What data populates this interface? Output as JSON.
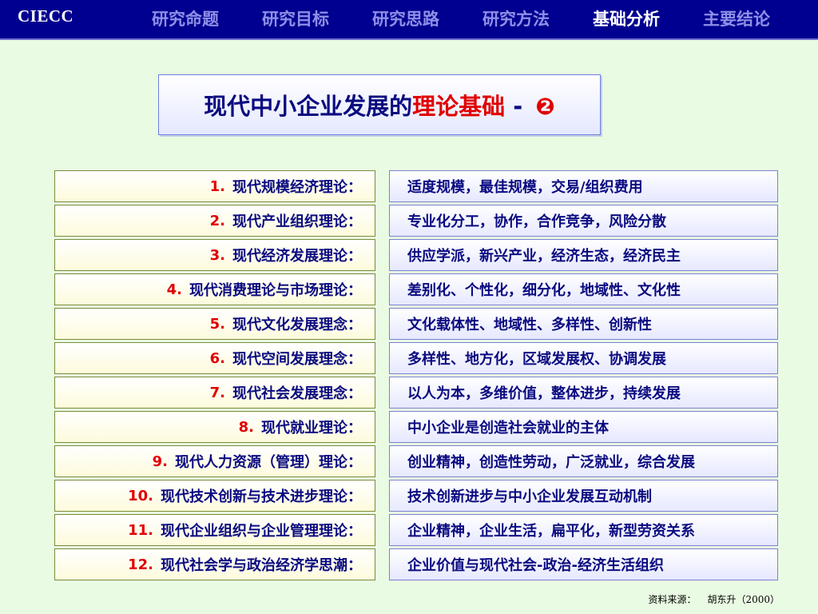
{
  "header": {
    "brand": "CIECC",
    "nav": [
      "研究命题",
      "研究目标",
      "研究思路",
      "研究方法",
      "基础分析",
      "主要结论"
    ],
    "active_index": 4
  },
  "title": {
    "prefix": "现代中小企业发展的",
    "highlight": "理论基础",
    "separator": " - ",
    "mark": "❷"
  },
  "theories": [
    {
      "num": "1.",
      "label": "现代规模经济理论：",
      "desc": "适度规模，最佳规模，交易/组织费用"
    },
    {
      "num": "2.",
      "label": "现代产业组织理论：",
      "desc": "专业化分工，协作，合作竞争，风险分散"
    },
    {
      "num": "3.",
      "label": "现代经济发展理论：",
      "desc": "供应学派，新兴产业，经济生态，经济民主"
    },
    {
      "num": "4.",
      "label": "现代消费理论与市场理论：",
      "desc": "差别化、个性化，细分化，地域性、文化性"
    },
    {
      "num": "5.",
      "label": "现代文化发展理念：",
      "desc": "文化载体性、地域性、多样性、创新性"
    },
    {
      "num": "6.",
      "label": "现代空间发展理念：",
      "desc": "多样性、地方化，区域发展权、协调发展"
    },
    {
      "num": "7.",
      "label": "现代社会发展理念：",
      "desc": "以人为本，多维价值，整体进步，持续发展"
    },
    {
      "num": "8.",
      "label": "现代就业理论：",
      "desc": "中小企业是创造社会就业的主体"
    },
    {
      "num": "9.",
      "label": "现代人力资源（管理）理论：",
      "desc": "创业精神，创造性劳动，广泛就业，综合发展"
    },
    {
      "num": "10.",
      "label": "现代技术创新与技术进步理论：",
      "desc": "技术创新进步与中小企业发展互动机制"
    },
    {
      "num": "11.",
      "label": "现代企业组织与企业管理理论：",
      "desc": "企业精神，企业生活，扁平化，新型劳资关系"
    },
    {
      "num": "12.",
      "label": "现代社会学与政治经济学思潮：",
      "desc": "企业价值与现代社会-政治-经济生活组织"
    }
  ],
  "source": {
    "label": "资料来源：",
    "value": "胡东升（2000）"
  }
}
